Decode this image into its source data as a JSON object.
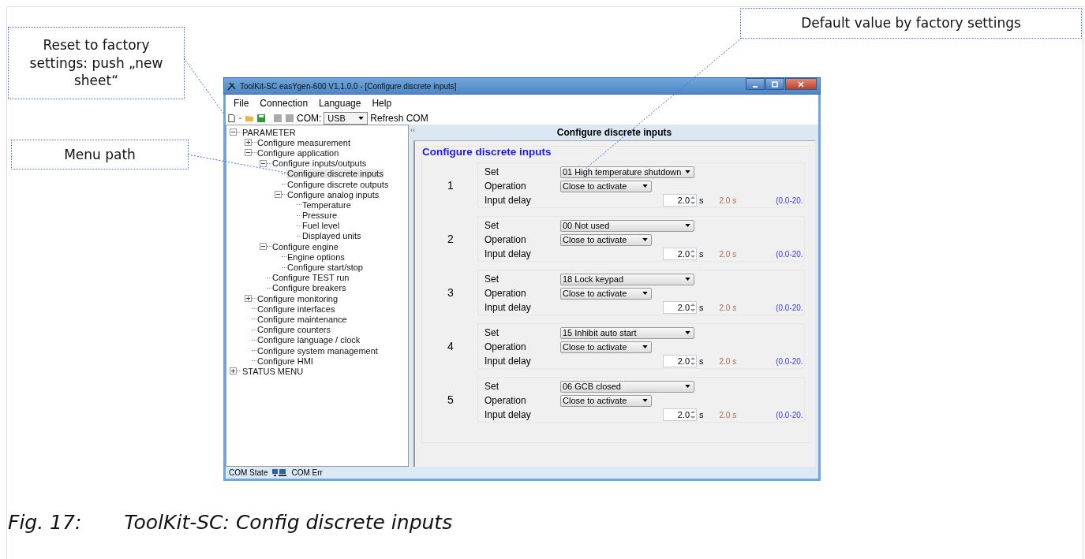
{
  "callouts": [
    {
      "text": "Reset to factory settings: push „new sheet“"
    },
    {
      "text": "Menu path"
    },
    {
      "text": "Default value by factory settings"
    }
  ],
  "window": {
    "title": "ToolKit-SC easYgen-600  V1.1.0.0 - [Configure discrete inputs]"
  },
  "menu": [
    "File",
    "Connection",
    "Language",
    "Help"
  ],
  "toolbar": {
    "com_label": "COM:",
    "com_value": "USB",
    "refresh": "Refresh COM"
  },
  "tree": [
    {
      "label": "PARAMETER",
      "expanded": true,
      "selected": false,
      "children": [
        {
          "label": "Configure measurement",
          "expanded": false,
          "selected": false
        },
        {
          "label": "Configure application",
          "expanded": true,
          "selected": false,
          "children": [
            {
              "label": "Configure inputs/outputs",
              "expanded": true,
              "selected": false,
              "children": [
                {
                  "label": "Configure discrete inputs",
                  "selected": true
                },
                {
                  "label": "Configure discrete outputs",
                  "selected": false
                },
                {
                  "label": "Configure analog inputs",
                  "expanded": true,
                  "selected": false,
                  "children": [
                    {
                      "label": "Temperature",
                      "selected": false
                    },
                    {
                      "label": "Pressure",
                      "selected": false
                    },
                    {
                      "label": "Fuel level",
                      "selected": false
                    },
                    {
                      "label": "Displayed units",
                      "selected": false
                    }
                  ]
                }
              ]
            },
            {
              "label": "Configure engine",
              "expanded": true,
              "selected": false,
              "children": [
                {
                  "label": "Engine options",
                  "selected": false
                },
                {
                  "label": "Configure start/stop",
                  "selected": false
                }
              ]
            },
            {
              "label": "Configure TEST run",
              "selected": false
            },
            {
              "label": "Configure breakers",
              "selected": false
            }
          ]
        },
        {
          "label": "Configure monitoring",
          "expanded": false,
          "selected": false
        },
        {
          "label": "Configure interfaces",
          "selected": false
        },
        {
          "label": "Configure maintenance",
          "selected": false
        },
        {
          "label": "Configure counters",
          "selected": false
        },
        {
          "label": "Configure language / clock",
          "selected": false
        },
        {
          "label": "Configure system management",
          "selected": false
        },
        {
          "label": "Configure HMI",
          "selected": false
        }
      ]
    },
    {
      "label": "STATUS MENU",
      "expanded": false,
      "selected": false
    }
  ],
  "panel": {
    "collapse": "‹‹",
    "header": "Configure discrete inputs",
    "title": "Configure discrete inputs"
  },
  "inputs": [
    {
      "number": "1",
      "set_label": "Set",
      "set": "01 High temperature shutdown",
      "operation_label": "Operation",
      "operation": "Close to activate",
      "delay_label": "Input delay",
      "delay": "2.0",
      "unit": "s",
      "default": "2.0 s",
      "range": "(0.0-20."
    },
    {
      "number": "2",
      "set_label": "Set",
      "set": "00 Not used",
      "operation_label": "Operation",
      "operation": "Close to activate",
      "delay_label": "Input delay",
      "delay": "2.0",
      "unit": "s",
      "default": "2.0 s",
      "range": "(0.0-20."
    },
    {
      "number": "3",
      "set_label": "Set",
      "set": "18 Lock keypad",
      "operation_label": "Operation",
      "operation": "Close to activate",
      "delay_label": "Input delay",
      "delay": "2.0",
      "unit": "s",
      "default": "2.0 s",
      "range": "(0.0-20."
    },
    {
      "number": "4",
      "set_label": "Set",
      "set": "15 Inhibit auto start",
      "operation_label": "Operation",
      "operation": "Close to activate",
      "delay_label": "Input delay",
      "delay": "2.0",
      "unit": "s",
      "default": "2.0 s",
      "range": "(0.0-20."
    },
    {
      "number": "5",
      "set_label": "Set",
      "set": "06 GCB closed",
      "operation_label": "Operation",
      "operation": "Close to activate",
      "delay_label": "Input delay",
      "delay": "2.0",
      "unit": "s",
      "default": "2.0 s",
      "range": "(0.0-20."
    }
  ],
  "status_bar": {
    "state": "COM State",
    "error": "COM Err"
  },
  "caption": {
    "number": "Fig. 17:",
    "text": "ToolKit-SC: Config discrete inputs"
  }
}
